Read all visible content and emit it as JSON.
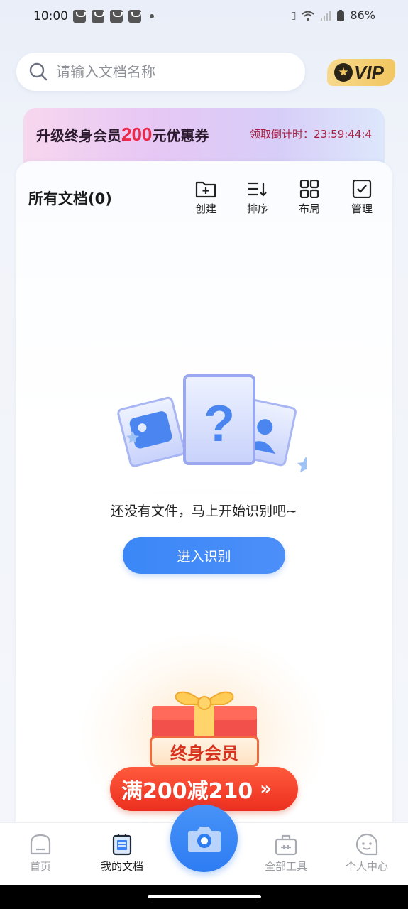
{
  "status": {
    "time": "10:00",
    "battery": "86%"
  },
  "search": {
    "placeholder": "请输入文档名称"
  },
  "vip": {
    "label": "VIP"
  },
  "promo": {
    "text_before": "升级终身会员",
    "amount": "200",
    "text_after": "元优惠券",
    "countdown": "领取倒计时：23:59:44:4"
  },
  "documents": {
    "title": "所有文档(0)",
    "tools": [
      {
        "label": "创建",
        "icon": "folder-plus-icon"
      },
      {
        "label": "排序",
        "icon": "sort-icon"
      },
      {
        "label": "布局",
        "icon": "grid-icon"
      },
      {
        "label": "管理",
        "icon": "checkbox-icon"
      }
    ],
    "empty_text": "还没有文件，马上开始识别吧~",
    "enter_button": "进入识别"
  },
  "gift_promo": {
    "tag": "终身会员",
    "offer": "满200减210",
    "arrow": "»"
  },
  "tabbar": {
    "items": [
      {
        "label": "首页",
        "icon": "home-icon"
      },
      {
        "label": "我的文档",
        "icon": "documents-icon",
        "active": true
      },
      {
        "label": "全部工具",
        "icon": "toolbox-icon"
      },
      {
        "label": "个人中心",
        "icon": "profile-icon"
      }
    ],
    "camera_icon": "camera-icon"
  },
  "colors": {
    "accent": "#3b87f7",
    "promo_red": "#ea2a4a",
    "vip_gold": "#f2c660"
  }
}
